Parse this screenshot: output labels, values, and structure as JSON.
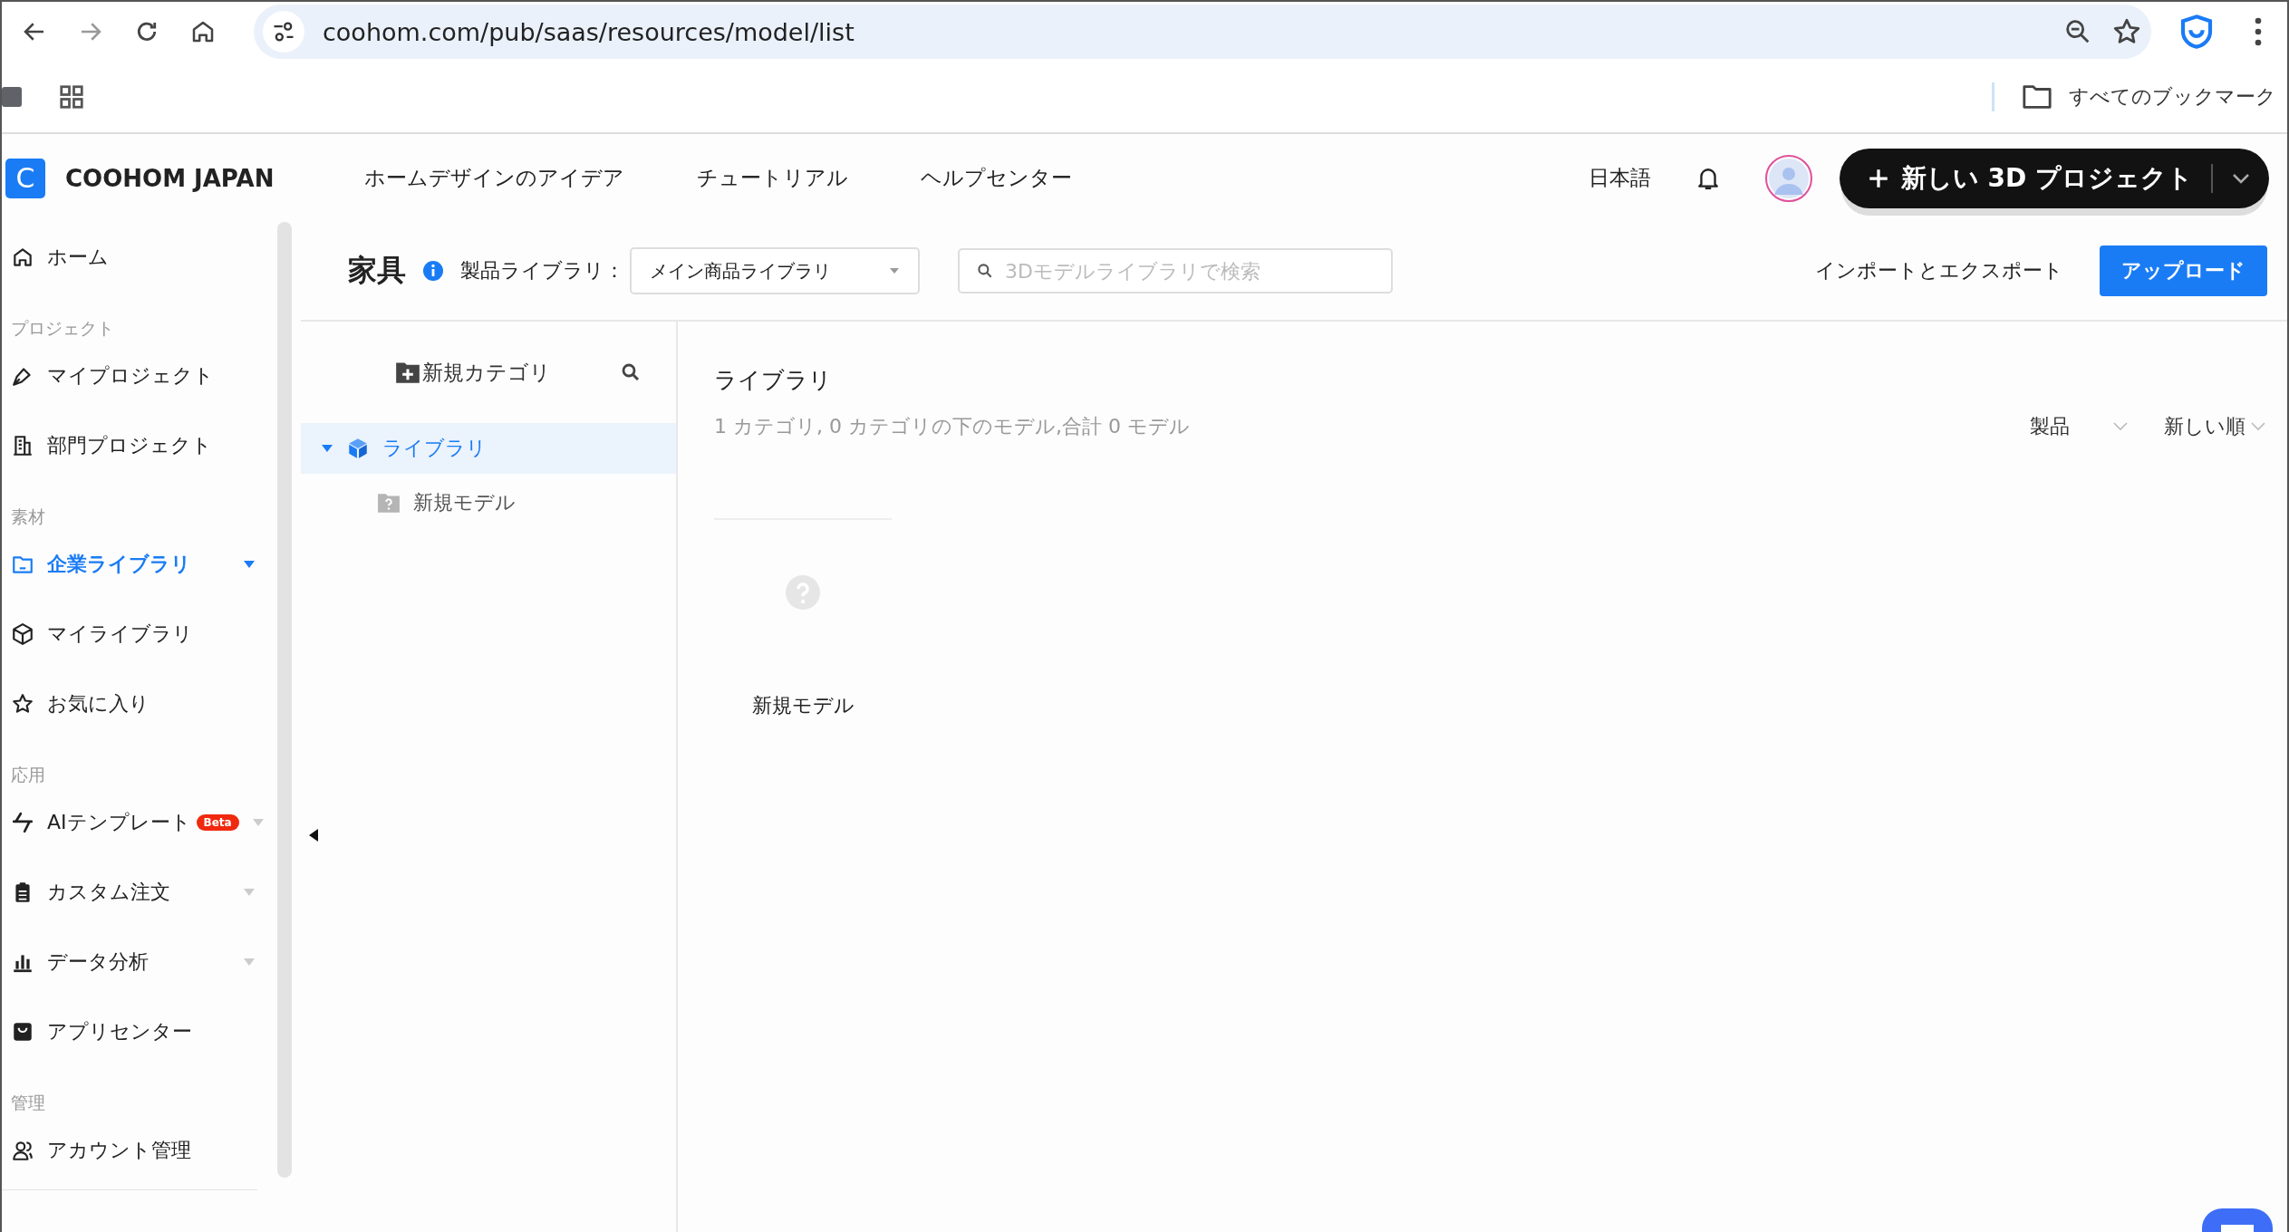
{
  "browser": {
    "url": "coohom.com/pub/saas/resources/model/list",
    "bookmarks_label": "すべてのブックマーク"
  },
  "header": {
    "logo_letter": "C",
    "brand": "COOHOM JAPAN",
    "nav": [
      "ホームデザインのアイデア",
      "チュートリアル",
      "ヘルプセンター"
    ],
    "language": "日本語",
    "new_project_button": "新しい 3D プロジェクト"
  },
  "sidebar": {
    "items": [
      {
        "kind": "item",
        "label": "ホーム",
        "selected": false,
        "expandable": false
      },
      {
        "kind": "heading",
        "label": "プロジェクト"
      },
      {
        "kind": "item",
        "label": "マイプロジェクト",
        "selected": false,
        "expandable": false
      },
      {
        "kind": "item",
        "label": "部門プロジェクト",
        "selected": false,
        "expandable": false
      },
      {
        "kind": "heading",
        "label": "素材"
      },
      {
        "kind": "item",
        "label": "企業ライブラリ",
        "selected": true,
        "expandable": true
      },
      {
        "kind": "item",
        "label": "マイライブラリ",
        "selected": false,
        "expandable": false
      },
      {
        "kind": "item",
        "label": "お気に入り",
        "selected": false,
        "expandable": false
      },
      {
        "kind": "heading",
        "label": "応用"
      },
      {
        "kind": "item",
        "label": "AIテンプレート",
        "badge": "Beta",
        "selected": false,
        "expandable": true
      },
      {
        "kind": "item",
        "label": "カスタム注文",
        "selected": false,
        "expandable": true
      },
      {
        "kind": "item",
        "label": "データ分析",
        "selected": false,
        "expandable": true
      },
      {
        "kind": "item",
        "label": "アプリセンター",
        "selected": false,
        "expandable": false
      },
      {
        "kind": "heading",
        "label": "管理"
      },
      {
        "kind": "item",
        "label": "アカウント管理",
        "selected": false,
        "expandable": false
      }
    ]
  },
  "toolbar": {
    "title": "家具",
    "library_label": "製品ライブラリ：",
    "library_select": "メイン商品ライブラリ",
    "search": {
      "placeholder": "3Dモデルライブラリで検索"
    },
    "import_export": "インポートとエクスポート",
    "upload_button": "アップロード"
  },
  "tree_panel": {
    "new_category": "新規カテゴリ",
    "tree": [
      {
        "label": "ライブラリ",
        "selected": true,
        "expanded": true,
        "children": [
          {
            "label": "新規モデル",
            "selected": false
          }
        ]
      }
    ]
  },
  "main": {
    "title": "ライブラリ",
    "summary": "1 カテゴリ, 0 カテゴリの下のモデル,合計 0 モデル",
    "filters": [
      "製品",
      "新しい順"
    ],
    "models": [
      {
        "name": "新規モデル"
      }
    ]
  }
}
